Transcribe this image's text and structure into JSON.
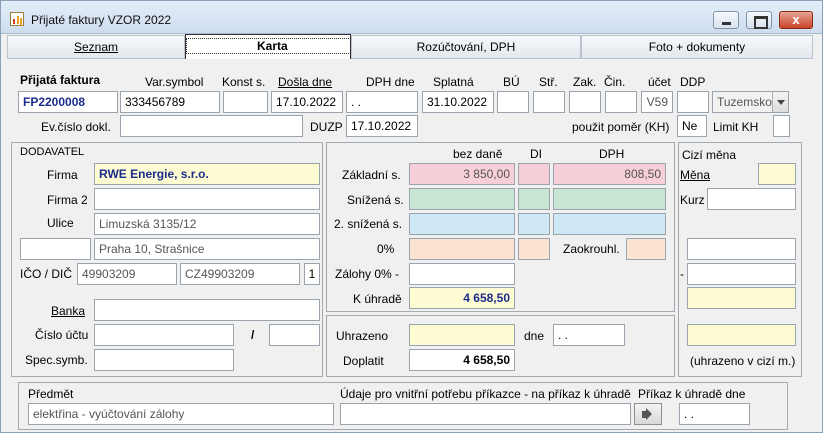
{
  "window": {
    "title": "Přijaté faktury VZOR 2022",
    "close_glyph": "x"
  },
  "tabs": [
    "Seznam",
    "Karta",
    "Rozúčtování, DPH",
    "Foto + dokumenty"
  ],
  "header": {
    "heading": "Přijatá faktura",
    "labels": {
      "var_symbol": "Var.symbol",
      "konst": "Konst s.",
      "dosla": "Došla dne",
      "dph_dne": "DPH dne",
      "splatna": "Splatná",
      "bu": "BÚ",
      "str": "Stř.",
      "zak": "Zak.",
      "cin": "Čin.",
      "ucet": "účet",
      "ddp": "DDP",
      "ev_cislo": "Ev.číslo dokl.",
      "duzp": "DUZP",
      "pouzit_pomer": "použit poměr (KH)",
      "limit_kh": "Limit KH"
    },
    "values": {
      "invoice_no": "FP2200008",
      "var_symbol": "333456789",
      "konst": "",
      "dosla": "17.10.2022",
      "dph_dne": " .  .",
      "splatna": "31.10.2022",
      "bu": "",
      "str": "",
      "zak": "",
      "cin": "",
      "ucet": "V59",
      "ddp": "",
      "tuzemsko": "Tuzemsko",
      "ev_cislo": "",
      "duzp": "17.10.2022",
      "pouzit_pomer": "Ne",
      "limit_kh": ""
    }
  },
  "supplier": {
    "section": "DODAVATEL",
    "labels": {
      "firma": "Firma",
      "firma2": "Firma 2",
      "ulice": "Ulice",
      "ico_dic": "IČO / DIČ",
      "banka": "Banka",
      "cislo_uctu": "Číslo účtu",
      "slash": "/",
      "spec": "Spec.symb."
    },
    "values": {
      "firma": "RWE Energie, s.r.o.",
      "firma2": "",
      "ulice": "Limuzská 3135/12",
      "psc": "",
      "mesto": "Praha 10, Strašnice",
      "ico": "49903209",
      "dic": "CZ49903209",
      "flag": "1",
      "banka": "",
      "cislo_uctu": "",
      "kod_banky": "",
      "spec": ""
    }
  },
  "amounts": {
    "col_headers": {
      "bez_dane": "bez daně",
      "di": "DI",
      "dph": "DPH"
    },
    "rows": {
      "zakladni": "Základní s.",
      "snizena": "Snížená s.",
      "snizena2": "2. snížená s.",
      "nula": "0%",
      "zalohy": "Zálohy 0% -",
      "k_uhrade": "K úhradě",
      "zaokrouhl": "Zaokrouhl."
    },
    "values": {
      "zakladni_bez": "3 850,00",
      "zakladni_dph": "808,50",
      "k_uhrade": "4 658,50"
    },
    "payment": {
      "uhrazeno_label": "Uhrazeno",
      "dne_label": "dne",
      "dne_value": " .  .",
      "doplatit_label": "Doplatit",
      "doplatit_value": "4 658,50"
    }
  },
  "foreign": {
    "title": "Cizí měna",
    "mena": "Měna",
    "kurz": "Kurz",
    "dash": "-",
    "note": "(uhrazeno v cizí m.)"
  },
  "footer": {
    "predmet_label": "Předmět",
    "predmet_value": "elektřina - vyúčtování zálohy",
    "udaje_label": "Údaje pro vnitřní potřebu příkazce - na příkaz k úhradě",
    "prikaz_label": "Příkaz k úhradě dne",
    "prikaz_value": " .  ."
  }
}
